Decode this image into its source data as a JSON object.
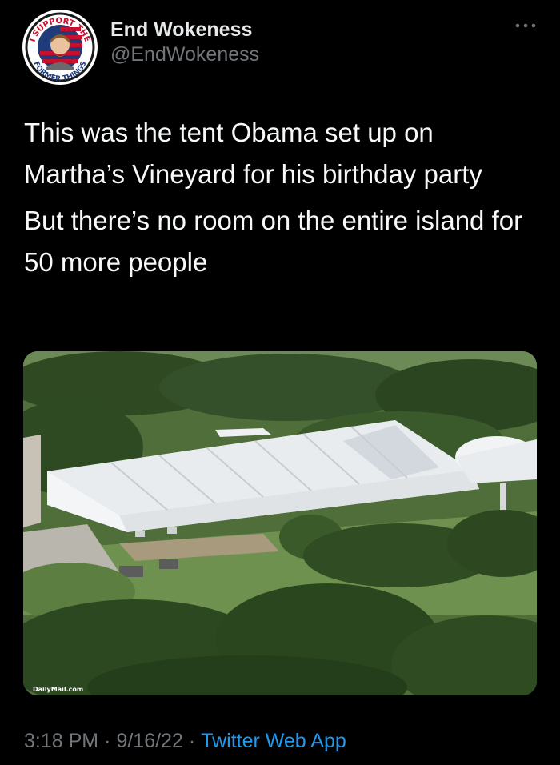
{
  "tweet": {
    "author": {
      "name": "End Wokeness",
      "handle": "@EndWokeness",
      "avatar_text_top": "I SUPPORT THE",
      "avatar_text_bottom": "FORMER THINGS"
    },
    "more_icon": "more-horizontal-icon",
    "paragraphs": [
      "This was the tent Obama set up on Martha’s Vineyard for his birthday party",
      "But there’s no room on the entire island for 50 more people"
    ],
    "media": {
      "watermark": "DailyMail.com"
    },
    "meta": {
      "time": "3:18 PM",
      "date": "9/16/22",
      "source": "Twitter Web App",
      "separator": "·"
    }
  },
  "colors": {
    "background": "#000000",
    "text": "#e7e9ea",
    "muted": "#71767b",
    "link": "#1d9bf0"
  }
}
